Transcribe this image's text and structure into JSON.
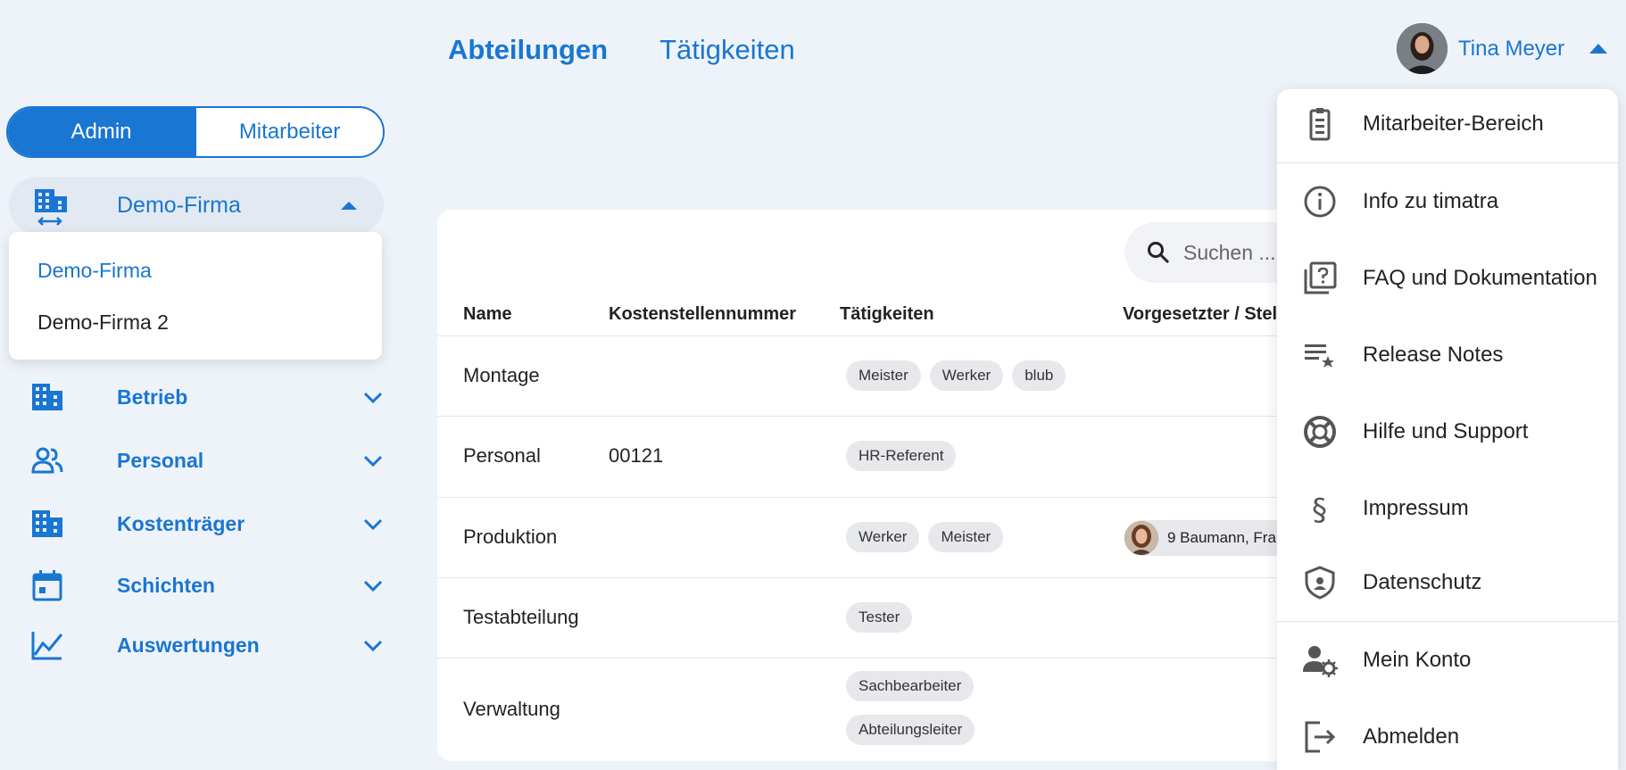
{
  "nav": {
    "tabs": [
      {
        "label": "Abteilungen"
      },
      {
        "label": "Tätigkeiten"
      }
    ]
  },
  "user": {
    "name": "Tina Meyer"
  },
  "role_toggle": {
    "admin": "Admin",
    "employee": "Mitarbeiter"
  },
  "company": {
    "selected": "Demo-Firma",
    "options": [
      "Demo-Firma",
      "Demo-Firma 2"
    ]
  },
  "sidebar": {
    "items": [
      {
        "label": "Betrieb",
        "icon": "building-icon"
      },
      {
        "label": "Personal",
        "icon": "people-icon"
      },
      {
        "label": "Kostenträger",
        "icon": "building-icon"
      },
      {
        "label": "Schichten",
        "icon": "calendar-icon"
      },
      {
        "label": "Auswertungen",
        "icon": "chart-icon"
      }
    ]
  },
  "search": {
    "placeholder": "Suchen ..."
  },
  "table": {
    "columns": [
      "Name",
      "Kostenstellennummer",
      "Tätigkeiten",
      "Vorgesetzter / Stel"
    ],
    "rows": [
      {
        "name": "Montage",
        "cost": "",
        "tags": [
          "Meister",
          "Werker",
          "blub"
        ],
        "supervisor": ""
      },
      {
        "name": "Personal",
        "cost": "00121",
        "tags": [
          "HR-Referent"
        ],
        "supervisor": ""
      },
      {
        "name": "Produktion",
        "cost": "",
        "tags": [
          "Werker",
          "Meister"
        ],
        "supervisor": "9 Baumann, Fra"
      },
      {
        "name": "Testabteilung",
        "cost": "",
        "tags": [
          "Tester"
        ],
        "supervisor": ""
      },
      {
        "name": "Verwaltung",
        "cost": "",
        "tags": [
          "Sachbearbeiter",
          "Abteilungsleiter"
        ],
        "supervisor": ""
      }
    ]
  },
  "user_menu": {
    "items": [
      {
        "label": "Mitarbeiter-Bereich",
        "icon": "badge-icon"
      },
      {
        "label": "Info zu timatra",
        "icon": "info-icon"
      },
      {
        "label": "FAQ und Dokumentation",
        "icon": "faq-icon"
      },
      {
        "label": "Release Notes",
        "icon": "release-notes-icon"
      },
      {
        "label": "Hilfe und Support",
        "icon": "lifebuoy-icon"
      },
      {
        "label": "Impressum",
        "icon": "section-sign-icon"
      },
      {
        "label": "Datenschutz",
        "icon": "shield-icon"
      },
      {
        "label": "Mein Konto",
        "icon": "account-settings-icon"
      },
      {
        "label": "Abmelden",
        "icon": "logout-icon"
      }
    ]
  },
  "colors": {
    "accent": "#1976d2",
    "background": "#eef3fa",
    "chip": "#e7e8eb"
  }
}
